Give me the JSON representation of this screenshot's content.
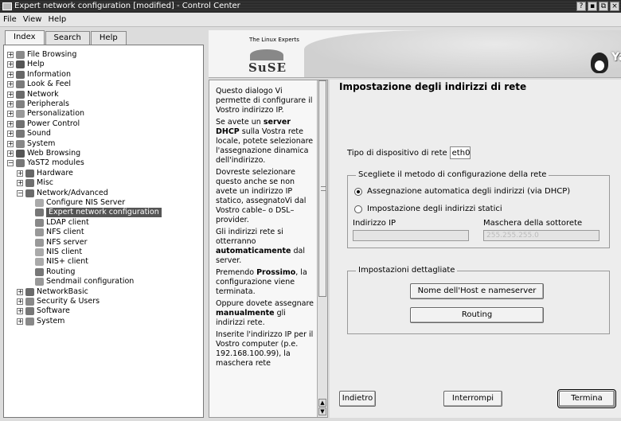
{
  "window": {
    "title": "Expert network configuration [modified] - Control Center",
    "buttons": [
      "?",
      "▪",
      "⧉",
      "×"
    ]
  },
  "menubar": [
    "File",
    "View",
    "Help"
  ],
  "sidebar": {
    "tabs": [
      "Index",
      "Search",
      "Help"
    ],
    "tree": [
      {
        "label": "File Browsing",
        "icon_color": "#8a8a8a"
      },
      {
        "label": "Help",
        "icon_color": "#555555"
      },
      {
        "label": "Information",
        "icon_color": "#666666"
      },
      {
        "label": "Look & Feel",
        "icon_color": "#7a7a7a"
      },
      {
        "label": "Network",
        "icon_color": "#6a6a6a"
      },
      {
        "label": "Peripherals",
        "icon_color": "#808080"
      },
      {
        "label": "Personalization",
        "icon_color": "#999999"
      },
      {
        "label": "Power Control",
        "icon_color": "#707070"
      },
      {
        "label": "Sound",
        "icon_color": "#777777"
      },
      {
        "label": "System",
        "icon_color": "#888888"
      },
      {
        "label": "Web Browsing",
        "icon_color": "#555555"
      },
      {
        "label": "YaST2 modules",
        "icon_color": "#777777"
      },
      {
        "label": "Hardware",
        "icon_color": "#666666"
      },
      {
        "label": "Misc",
        "icon_color": "#707070"
      },
      {
        "label": "Network/Advanced",
        "icon_color": "#6a6a6a"
      },
      {
        "label": "Configure NIS Server",
        "icon_color": "#aaaaaa"
      },
      {
        "label": "Expert network configuration",
        "icon_color": "#777777"
      },
      {
        "label": "LDAP client",
        "icon_color": "#888888"
      },
      {
        "label": "NFS client",
        "icon_color": "#999999"
      },
      {
        "label": "NFS server",
        "icon_color": "#999999"
      },
      {
        "label": "NIS client",
        "icon_color": "#aaaaaa"
      },
      {
        "label": "NIS+ client",
        "icon_color": "#aaaaaa"
      },
      {
        "label": "Routing",
        "icon_color": "#777777"
      },
      {
        "label": "Sendmail configuration",
        "icon_color": "#999999"
      },
      {
        "label": "NetworkBasic",
        "icon_color": "#6a6a6a"
      },
      {
        "label": "Security & Users",
        "icon_color": "#888888"
      },
      {
        "label": "Software",
        "icon_color": "#777777"
      },
      {
        "label": "System",
        "icon_color": "#888888"
      }
    ]
  },
  "banner": {
    "linux_experts": "The Linux Experts",
    "suse": "SuSE",
    "yast": "YaST"
  },
  "help": {
    "paragraphs": [
      "Questo dialogo Vi permette di configurare il Vostro indirizzo IP.",
      "Se avete un server DHCP sulla Vostra rete locale, potete selezionare l'assegnazione dinamica dell'indirizzo.",
      "Dovreste selezionare questo anche se non avete un indirizzo IP statico, assegnatoVi dal Vostro cable– o DSL–provider.",
      "Gli indirizzi rete si otterranno automaticamente dal server.",
      "Premendo Prossimo, la configurazione viene terminata.",
      "Oppure dovete assegnare manualmente gli indirizzi rete.",
      "Inserite l'indirizzo IP per il Vostro computer (p.e. 192.168.100.99), la maschera rete"
    ]
  },
  "content": {
    "title": "Impostazione degli indirizzi di rete",
    "device_type_label": "Tipo di dispositivo di rete",
    "device_type_value": "eth0",
    "method_group_label": "Scegliete il metodo di configurazione della rete",
    "radio_dhcp": "Assegnazione automatica degli indirizzi (via DHCP)",
    "radio_static": "Impostazione degli indirizzi statici",
    "ip_label": "Indirizzo IP",
    "ip_value": "",
    "mask_label": "Maschera della sottorete",
    "mask_value": "255.255.255.0",
    "details_group_label": "Impostazioni dettagliate",
    "hostname_button": "Nome dell'Host e nameserver",
    "routing_button": "Routing",
    "back_button": "Indietro",
    "abort_button": "Interrompi",
    "finish_button": "Termina"
  }
}
